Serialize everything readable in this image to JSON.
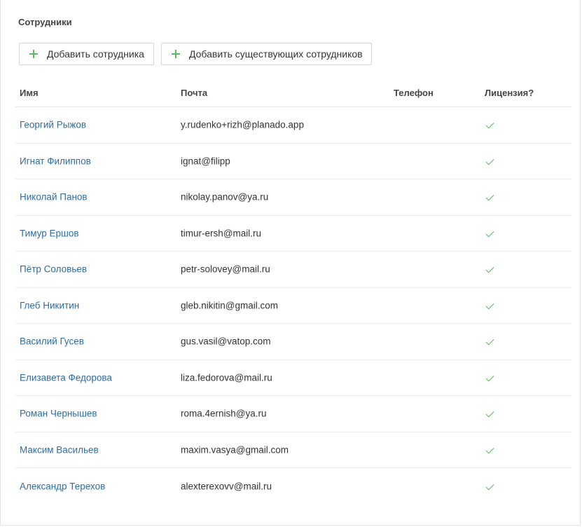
{
  "section": {
    "title": "Сотрудники"
  },
  "toolbar": {
    "add_label": "Добавить сотрудника",
    "add_existing_label": "Добавить существующих сотрудников"
  },
  "table": {
    "headers": {
      "name": "Имя",
      "email": "Почта",
      "phone": "Телефон",
      "license": "Лицензия?"
    },
    "rows": [
      {
        "name": "Георгий Рыжов",
        "email": "y.rudenko+rizh@planado.app",
        "phone": "",
        "license": true
      },
      {
        "name": "Игнат Филиппов",
        "email": "ignat@filipp",
        "phone": "",
        "license": true
      },
      {
        "name": "Николай Панов",
        "email": "nikolay.panov@ya.ru",
        "phone": "",
        "license": true
      },
      {
        "name": "Тимур Ершов",
        "email": "timur-ersh@mail.ru",
        "phone": "",
        "license": true
      },
      {
        "name": "Пётр Соловьев",
        "email": "petr-solovey@mail.ru",
        "phone": "",
        "license": true
      },
      {
        "name": "Глеб Никитин",
        "email": "gleb.nikitin@gmail.com",
        "phone": "",
        "license": true
      },
      {
        "name": "Василий Гусев",
        "email": "gus.vasil@vatop.com",
        "phone": "",
        "license": true
      },
      {
        "name": "Елизавета Федорова",
        "email": "liza.fedorova@mail.ru",
        "phone": "",
        "license": true
      },
      {
        "name": "Роман Чернышев",
        "email": "roma.4ernish@ya.ru",
        "phone": "",
        "license": true
      },
      {
        "name": "Максим Васильев",
        "email": "maxim.vasya@gmail.com",
        "phone": "",
        "license": true
      },
      {
        "name": "Александр Терехов",
        "email": "alexterexovv@mail.ru",
        "phone": "",
        "license": true
      }
    ]
  },
  "colors": {
    "link": "#2e6da4",
    "accent_green": "#5cb85c",
    "border": "#e3e3e3"
  },
  "icons": {
    "plus": "plus-icon",
    "check": "check-icon"
  }
}
